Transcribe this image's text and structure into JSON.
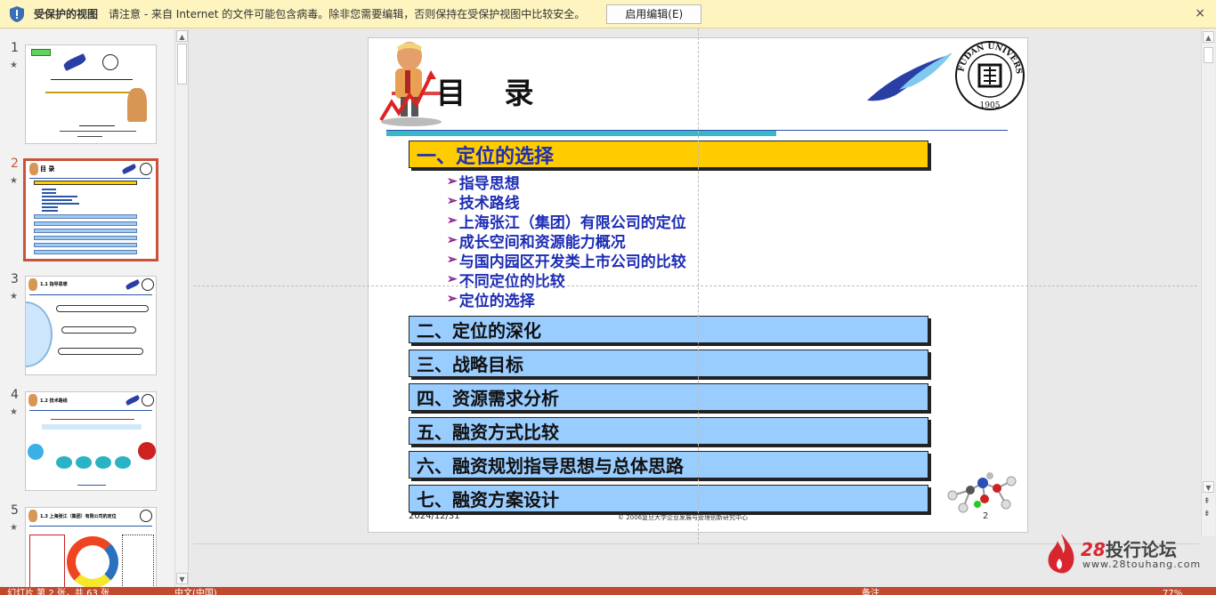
{
  "protected_view": {
    "title": "受保护的视图",
    "message": "请注意 - 来自 Internet 的文件可能包含病毒。除非您需要编辑，否则保持在受保护视图中比较安全。",
    "enable_button": "启用编辑(E)",
    "close": "×"
  },
  "thumbnails": [
    {
      "num": "1",
      "star": "★",
      "mini_title": "",
      "active": false
    },
    {
      "num": "2",
      "star": "★",
      "mini_title": "目 录",
      "active": true
    },
    {
      "num": "3",
      "star": "★",
      "mini_title": "1.1 指导思想",
      "active": false
    },
    {
      "num": "4",
      "star": "★",
      "mini_title": "1.2 技术路线",
      "active": false
    },
    {
      "num": "5",
      "star": "★",
      "mini_title": "1.3 上海张江（集团）有限公司的定位",
      "active": false
    }
  ],
  "slide": {
    "title": "目 录",
    "sections": [
      {
        "label": "一、定位的选择",
        "active": true
      },
      {
        "label": "二、定位的深化",
        "active": false
      },
      {
        "label": "三、战略目标",
        "active": false
      },
      {
        "label": "四、资源需求分析",
        "active": false
      },
      {
        "label": "五、融资方式比较",
        "active": false
      },
      {
        "label": "六、融资规划指导思想与总体思路",
        "active": false
      },
      {
        "label": "七、融资方案设计",
        "active": false
      }
    ],
    "sub_items": [
      "指导思想",
      "技术路线",
      "上海张江（集团）有限公司的定位",
      "成长空间和资源能力概况",
      "与国内园区开发类上市公司的比较",
      "不同定位的比较",
      "定位的选择"
    ],
    "sub_arrow": "➢",
    "footer_date": "2024/12/31",
    "footer_copy": "© 2006复旦大学企业发展与管理创新研究中心",
    "page_number": "2",
    "seal_text": "FUDAN UNIVERSITY",
    "seal_year": "1905"
  },
  "status_bar": {
    "slide_info": "幻灯片 第 2 张，共 63 张",
    "language": "中文(中国)",
    "notes": "备注",
    "zoom": "77%"
  },
  "watermark": {
    "brand_num": "28",
    "brand_text": "投行论坛",
    "url": "www.28touhang.com"
  },
  "colors": {
    "active_section": "#ffcc00",
    "normal_section": "#99ccff",
    "text_blue": "#1d2db4",
    "status_bar": "#c1492d"
  }
}
